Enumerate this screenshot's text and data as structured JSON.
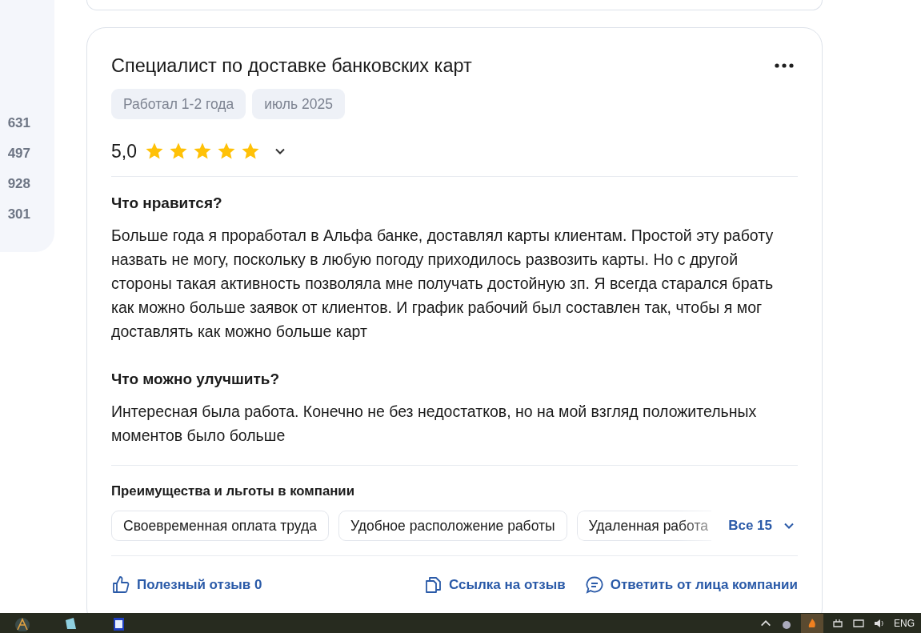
{
  "sidebar": {
    "stats": [
      {
        "value": "631"
      },
      {
        "value": "497"
      },
      {
        "value": "928"
      },
      {
        "value": "301"
      }
    ]
  },
  "review": {
    "title": "Специалист по доставке банковских карт",
    "tags": [
      "Работал 1-2 года",
      "июль 2025"
    ],
    "rating": "5,0",
    "stars": 5,
    "sections": [
      {
        "heading": "Что нравится?",
        "text": "Больше года я проработал в Альфа банке, доставлял карты клиентам. Простой эту работу назвать не могу, поскольку в любую погоду приходилось развозить карты. Но с другой стороны такая активность позволяла мне получать достойную зп. Я всегда старался брать как можно больше заявок от клиентов. И график рабочий был составлен так, чтобы я мог доставлять как можно больше карт"
      },
      {
        "heading": "Что можно улучшить?",
        "text": "Интересная была работа. Конечно не без недостатков, но на мой взгляд положительных моментов было больше"
      }
    ],
    "benefits": {
      "heading": "Преимущества и льготы в компании",
      "items": [
        "Своевременная оплата труда",
        "Удобное расположение работы",
        "Удаленная работа"
      ],
      "more": "Все 15"
    },
    "actions": [
      {
        "kind": "like",
        "label": "Полезный отзыв 0"
      },
      {
        "kind": "link",
        "label": "Ссылка на отзыв"
      },
      {
        "kind": "reply",
        "label": "Ответить от лица компании"
      }
    ]
  },
  "taskbar": {
    "language": "ENG"
  }
}
